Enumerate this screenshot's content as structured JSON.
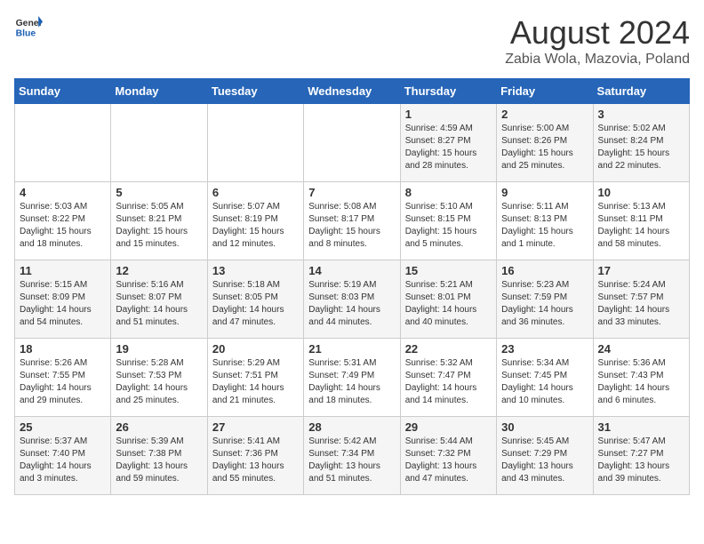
{
  "header": {
    "logo_general": "General",
    "logo_blue": "Blue",
    "month_year": "August 2024",
    "location": "Zabia Wola, Mazovia, Poland"
  },
  "weekdays": [
    "Sunday",
    "Monday",
    "Tuesday",
    "Wednesday",
    "Thursday",
    "Friday",
    "Saturday"
  ],
  "weeks": [
    [
      {
        "day": "",
        "info": ""
      },
      {
        "day": "",
        "info": ""
      },
      {
        "day": "",
        "info": ""
      },
      {
        "day": "",
        "info": ""
      },
      {
        "day": "1",
        "info": "Sunrise: 4:59 AM\nSunset: 8:27 PM\nDaylight: 15 hours\nand 28 minutes."
      },
      {
        "day": "2",
        "info": "Sunrise: 5:00 AM\nSunset: 8:26 PM\nDaylight: 15 hours\nand 25 minutes."
      },
      {
        "day": "3",
        "info": "Sunrise: 5:02 AM\nSunset: 8:24 PM\nDaylight: 15 hours\nand 22 minutes."
      }
    ],
    [
      {
        "day": "4",
        "info": "Sunrise: 5:03 AM\nSunset: 8:22 PM\nDaylight: 15 hours\nand 18 minutes."
      },
      {
        "day": "5",
        "info": "Sunrise: 5:05 AM\nSunset: 8:21 PM\nDaylight: 15 hours\nand 15 minutes."
      },
      {
        "day": "6",
        "info": "Sunrise: 5:07 AM\nSunset: 8:19 PM\nDaylight: 15 hours\nand 12 minutes."
      },
      {
        "day": "7",
        "info": "Sunrise: 5:08 AM\nSunset: 8:17 PM\nDaylight: 15 hours\nand 8 minutes."
      },
      {
        "day": "8",
        "info": "Sunrise: 5:10 AM\nSunset: 8:15 PM\nDaylight: 15 hours\nand 5 minutes."
      },
      {
        "day": "9",
        "info": "Sunrise: 5:11 AM\nSunset: 8:13 PM\nDaylight: 15 hours\nand 1 minute."
      },
      {
        "day": "10",
        "info": "Sunrise: 5:13 AM\nSunset: 8:11 PM\nDaylight: 14 hours\nand 58 minutes."
      }
    ],
    [
      {
        "day": "11",
        "info": "Sunrise: 5:15 AM\nSunset: 8:09 PM\nDaylight: 14 hours\nand 54 minutes."
      },
      {
        "day": "12",
        "info": "Sunrise: 5:16 AM\nSunset: 8:07 PM\nDaylight: 14 hours\nand 51 minutes."
      },
      {
        "day": "13",
        "info": "Sunrise: 5:18 AM\nSunset: 8:05 PM\nDaylight: 14 hours\nand 47 minutes."
      },
      {
        "day": "14",
        "info": "Sunrise: 5:19 AM\nSunset: 8:03 PM\nDaylight: 14 hours\nand 44 minutes."
      },
      {
        "day": "15",
        "info": "Sunrise: 5:21 AM\nSunset: 8:01 PM\nDaylight: 14 hours\nand 40 minutes."
      },
      {
        "day": "16",
        "info": "Sunrise: 5:23 AM\nSunset: 7:59 PM\nDaylight: 14 hours\nand 36 minutes."
      },
      {
        "day": "17",
        "info": "Sunrise: 5:24 AM\nSunset: 7:57 PM\nDaylight: 14 hours\nand 33 minutes."
      }
    ],
    [
      {
        "day": "18",
        "info": "Sunrise: 5:26 AM\nSunset: 7:55 PM\nDaylight: 14 hours\nand 29 minutes."
      },
      {
        "day": "19",
        "info": "Sunrise: 5:28 AM\nSunset: 7:53 PM\nDaylight: 14 hours\nand 25 minutes."
      },
      {
        "day": "20",
        "info": "Sunrise: 5:29 AM\nSunset: 7:51 PM\nDaylight: 14 hours\nand 21 minutes."
      },
      {
        "day": "21",
        "info": "Sunrise: 5:31 AM\nSunset: 7:49 PM\nDaylight: 14 hours\nand 18 minutes."
      },
      {
        "day": "22",
        "info": "Sunrise: 5:32 AM\nSunset: 7:47 PM\nDaylight: 14 hours\nand 14 minutes."
      },
      {
        "day": "23",
        "info": "Sunrise: 5:34 AM\nSunset: 7:45 PM\nDaylight: 14 hours\nand 10 minutes."
      },
      {
        "day": "24",
        "info": "Sunrise: 5:36 AM\nSunset: 7:43 PM\nDaylight: 14 hours\nand 6 minutes."
      }
    ],
    [
      {
        "day": "25",
        "info": "Sunrise: 5:37 AM\nSunset: 7:40 PM\nDaylight: 14 hours\nand 3 minutes."
      },
      {
        "day": "26",
        "info": "Sunrise: 5:39 AM\nSunset: 7:38 PM\nDaylight: 13 hours\nand 59 minutes."
      },
      {
        "day": "27",
        "info": "Sunrise: 5:41 AM\nSunset: 7:36 PM\nDaylight: 13 hours\nand 55 minutes."
      },
      {
        "day": "28",
        "info": "Sunrise: 5:42 AM\nSunset: 7:34 PM\nDaylight: 13 hours\nand 51 minutes."
      },
      {
        "day": "29",
        "info": "Sunrise: 5:44 AM\nSunset: 7:32 PM\nDaylight: 13 hours\nand 47 minutes."
      },
      {
        "day": "30",
        "info": "Sunrise: 5:45 AM\nSunset: 7:29 PM\nDaylight: 13 hours\nand 43 minutes."
      },
      {
        "day": "31",
        "info": "Sunrise: 5:47 AM\nSunset: 7:27 PM\nDaylight: 13 hours\nand 39 minutes."
      }
    ]
  ]
}
